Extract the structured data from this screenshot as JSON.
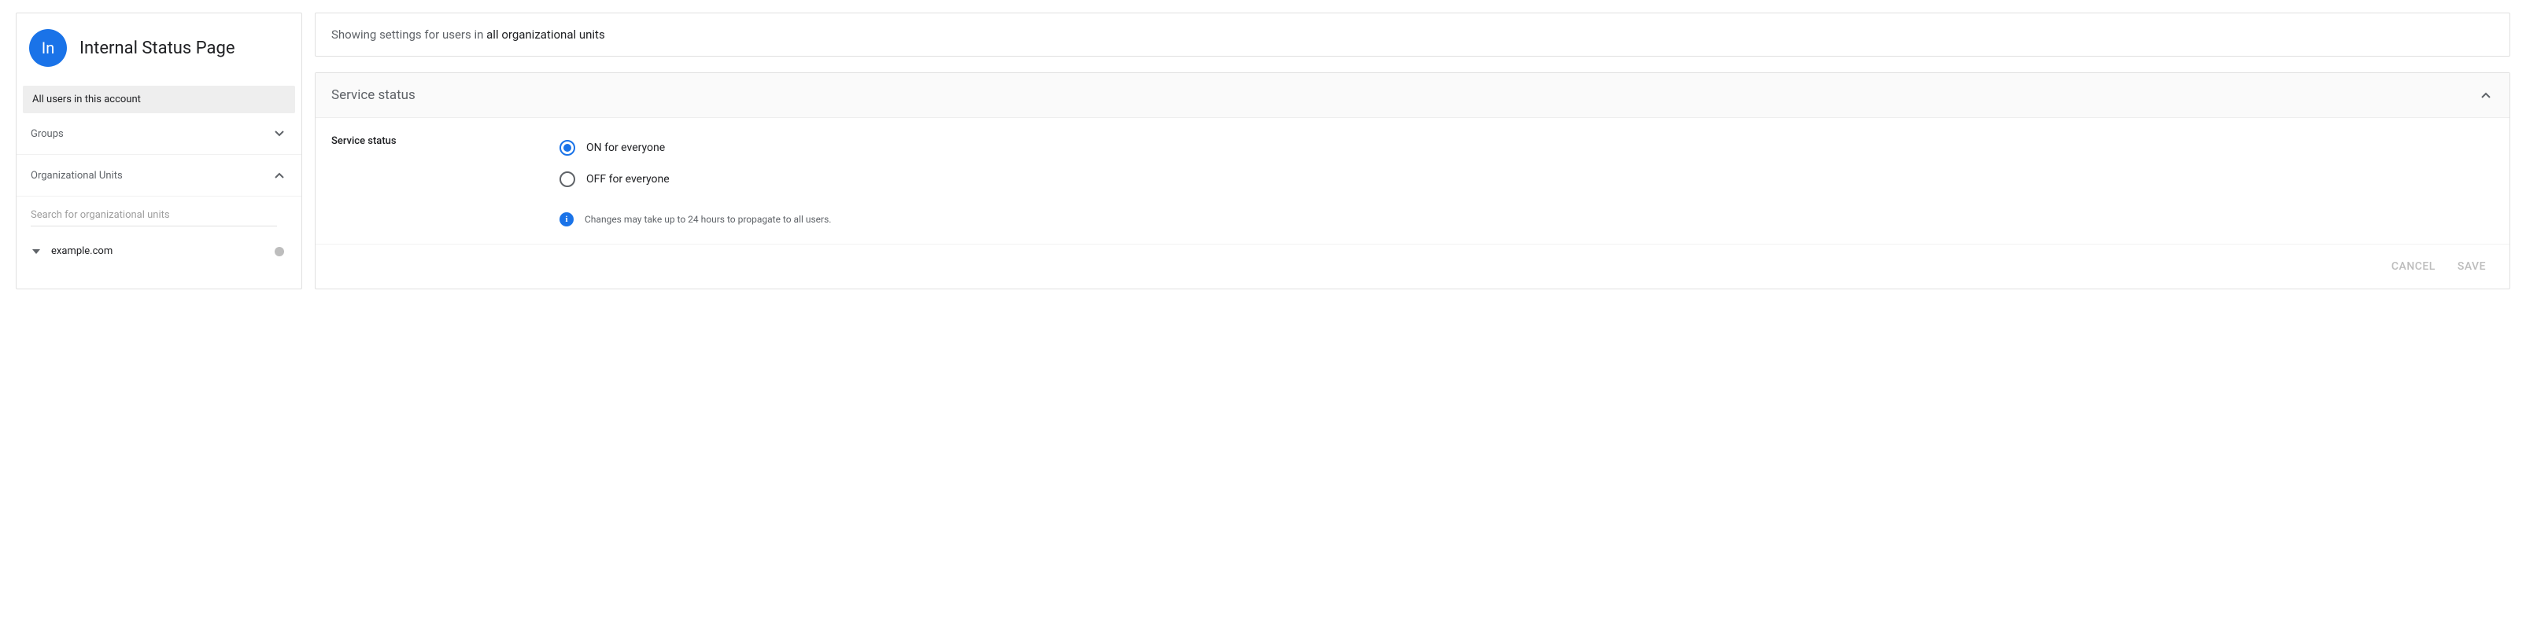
{
  "sidebar": {
    "avatar_initials": "In",
    "title": "Internal Status Page",
    "active_item": "All users in this account",
    "rows": {
      "groups": "Groups",
      "org_units": "Organizational Units"
    },
    "search_placeholder": "Search for organizational units",
    "ou_tree": {
      "root": "example.com"
    }
  },
  "main": {
    "scope": {
      "prefix": "Showing settings for users in ",
      "target": "all organizational units"
    },
    "card": {
      "title": "Service status",
      "setting_label": "Service status",
      "options": {
        "on": "ON for everyone",
        "off": "OFF for everyone"
      },
      "info": "Changes may take up to 24 hours to propagate to all users.",
      "buttons": {
        "cancel": "CANCEL",
        "save": "SAVE"
      }
    }
  }
}
